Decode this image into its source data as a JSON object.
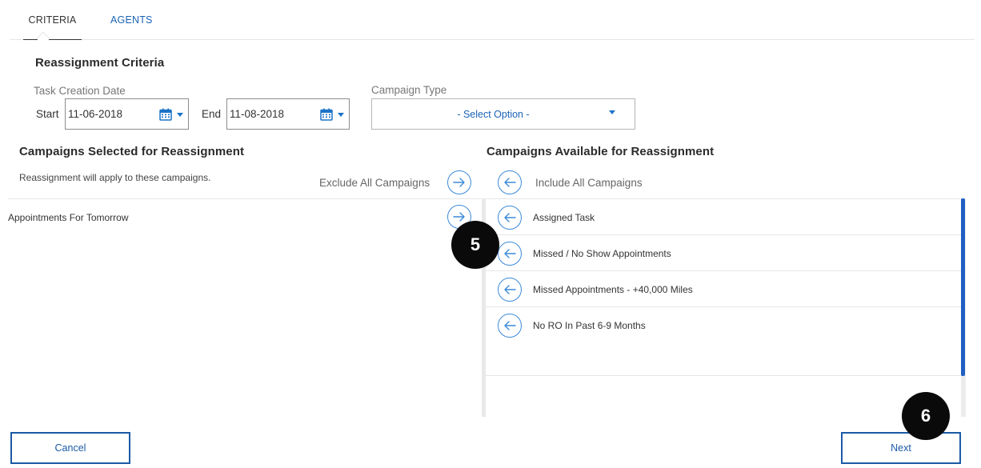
{
  "tabs": [
    {
      "label": "CRITERIA",
      "active": true
    },
    {
      "label": "AGENTS",
      "active": false
    }
  ],
  "criteria": {
    "title": "Reassignment Criteria",
    "task_creation_date_label": "Task Creation Date",
    "start_label": "Start",
    "start_value": "11-06-2018",
    "end_label": "End",
    "end_value": "11-08-2018",
    "campaign_type_label": "Campaign Type",
    "campaign_type_value": "- Select Option -"
  },
  "selected": {
    "title": "Campaigns Selected for Reassignment",
    "help_text": "Reassignment will apply to these campaigns.",
    "exclude_all_label": "Exclude All Campaigns",
    "items": [
      {
        "label": "Appointments For Tomorrow"
      }
    ]
  },
  "available": {
    "title": "Campaigns Available for Reassignment",
    "include_all_label": "Include All Campaigns",
    "items": [
      {
        "label": "Assigned Task"
      },
      {
        "label": "Missed / No Show Appointments"
      },
      {
        "label": "Missed Appointments - +40,000 Miles"
      },
      {
        "label": "No RO In Past 6-9 Months"
      }
    ]
  },
  "footer": {
    "cancel_label": "Cancel",
    "next_label": "Next"
  },
  "badges": {
    "step5": "5",
    "step6": "6"
  },
  "icons": {
    "calendar": "calendar-icon",
    "arrow_right": "arrow-right-icon",
    "arrow_left": "arrow-left-icon",
    "chevron_down": "chevron-down-icon"
  },
  "colors": {
    "accent": "#1a63b6",
    "circle_border": "#3b8ad9",
    "scroll_thumb": "#1f5fc4",
    "badge": "#0a0a0a"
  }
}
